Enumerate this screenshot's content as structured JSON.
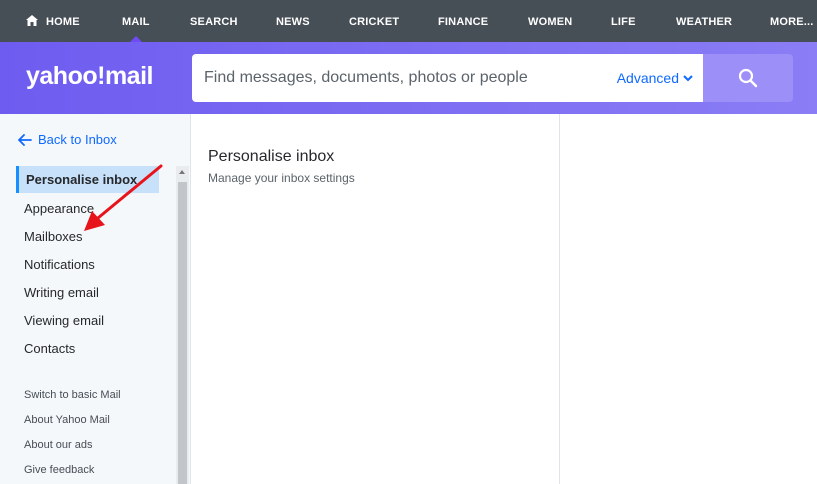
{
  "topnav": {
    "items": [
      {
        "label": "HOME",
        "icon": "home-icon"
      },
      {
        "label": "MAIL",
        "active": true
      },
      {
        "label": "SEARCH"
      },
      {
        "label": "NEWS"
      },
      {
        "label": "CRICKET"
      },
      {
        "label": "FINANCE"
      },
      {
        "label": "WOMEN"
      },
      {
        "label": "LIFE"
      },
      {
        "label": "WEATHER"
      },
      {
        "label": "MORE..."
      }
    ]
  },
  "header": {
    "logo": "yahoo!mail",
    "search_placeholder": "Find messages, documents, photos or people",
    "advanced_label": "Advanced",
    "search_icon": "search-icon"
  },
  "sidebar": {
    "back_label": "Back to Inbox",
    "items": [
      {
        "label": "Personalise inbox",
        "active": true
      },
      {
        "label": "Appearance"
      },
      {
        "label": "Mailboxes"
      },
      {
        "label": "Notifications"
      },
      {
        "label": "Writing email"
      },
      {
        "label": "Viewing email"
      },
      {
        "label": "Contacts"
      }
    ],
    "links": [
      "Switch to basic Mail",
      "About Yahoo Mail",
      "About our ads",
      "Give feedback"
    ]
  },
  "main": {
    "title": "Personalise inbox",
    "subtitle": "Manage your inbox settings"
  },
  "colors": {
    "nav_bg": "#464e56",
    "header_bg": "#7b68ee",
    "accent_blue": "#0f69ff",
    "active_item_bg": "#c7e1fb",
    "annotation_arrow": "#e8141c"
  }
}
